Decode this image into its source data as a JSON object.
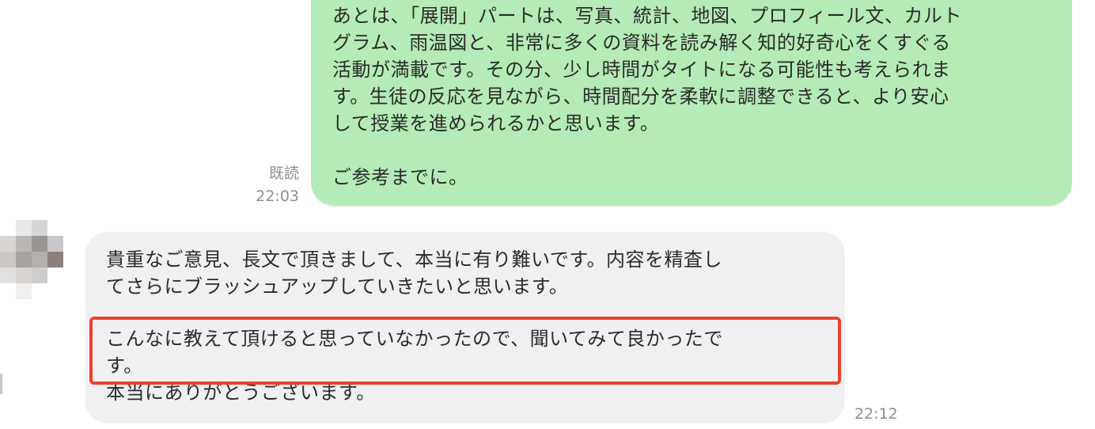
{
  "outgoing": {
    "text": "あとは、「展開」パートは、写真、統計、地図、プロフィール文、カルト\nグラム、雨温図と、非常に多くの資料を読み解く知的好奇心をくすぐる\n活動が満載です。その分、少し時間がタイトになる可能性も考えられま\nす。生徒の反応を見ながら、時間配分を柔軟に調整できると、より安心\nして授業を進められるかと思います。\n\nご参考までに。",
    "read_label": "既読",
    "time": "22:03"
  },
  "incoming": {
    "para1": "貴重なご意見、長文で頂きまして、本当に有り難いです。内容を精査し\nてさらにブラッシュアップしていきたいと思います。",
    "para2": "こんなに教えて頂けると思っていなかったので、聞いてみて良かったで\nす。",
    "para3": "本当にありがとうございます。",
    "time": "22:12"
  },
  "colors": {
    "outgoing_bubble": "#b5ebb6",
    "incoming_bubble": "#f0f0f3",
    "highlight": "#e8432b",
    "meta_text": "#8e8e93"
  }
}
